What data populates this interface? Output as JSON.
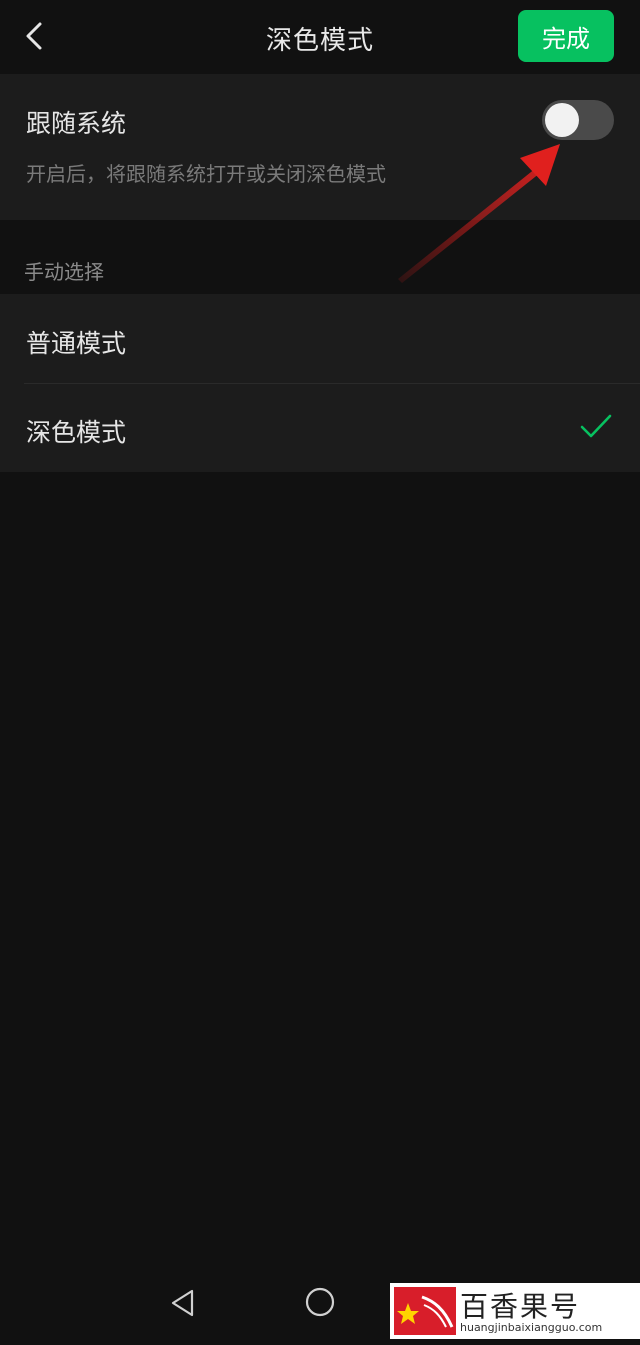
{
  "header": {
    "title": "深色模式",
    "done_label": "完成"
  },
  "follow_system": {
    "label": "跟随系统",
    "description": "开启后，将跟随系统打开或关闭深色模式",
    "enabled": false
  },
  "manual": {
    "section_label": "手动选择",
    "options": [
      {
        "label": "普通模式",
        "selected": false
      },
      {
        "label": "深色模式",
        "selected": true
      }
    ]
  },
  "colors": {
    "accent": "#07c160",
    "background": "#111111",
    "card": "#1c1c1c",
    "annotation": "#e0201e"
  },
  "icons": {
    "back": "chevron-left-icon",
    "check": "check-icon",
    "nav_back": "triangle-back-icon",
    "nav_home": "circle-home-icon"
  },
  "watermark": {
    "title": "百香果号",
    "url": "huangjinbaixiangguo.com"
  }
}
